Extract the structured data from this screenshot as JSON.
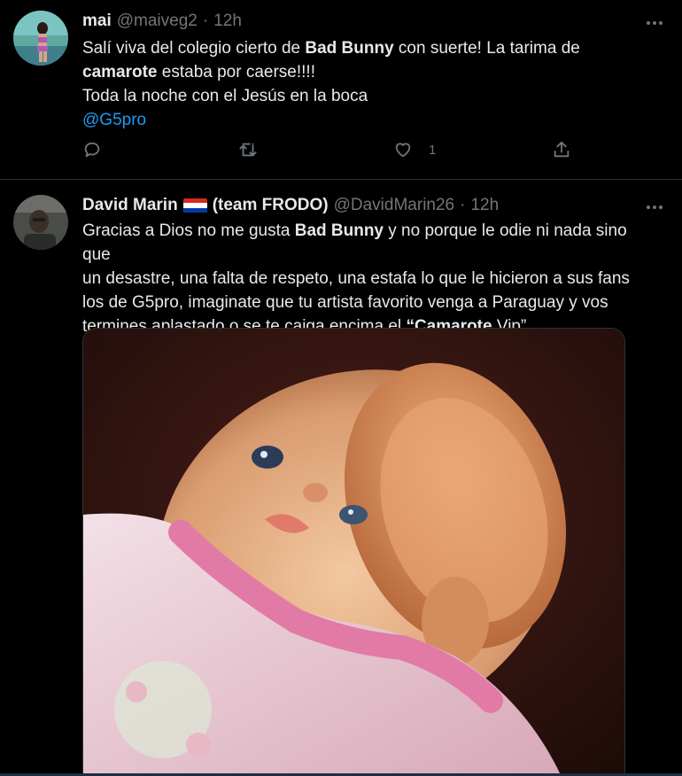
{
  "tweet1": {
    "display_name": "mai",
    "handle": "@maiveg2",
    "separator": "·",
    "time": "12h",
    "text": {
      "l1_a": "Salí viva del colegio cierto de ",
      "l1_b": "Bad Bunny",
      "l1_c": " con suerte! La tarima de",
      "l2_a": "camarote",
      "l2_b": " estaba por caerse!!!!",
      "l3": "Toda la noche con el Jesús en la boca",
      "mention": "@G5pro"
    },
    "actions": {
      "reply_icon": "reply-icon",
      "retweet_icon": "retweet-icon",
      "like_icon": "heart-icon",
      "like_count": "1",
      "share_icon": "share-icon"
    }
  },
  "tweet2": {
    "display_name": "David Marin",
    "flag_icon": "paraguay-flag-icon",
    "team": "(team FRODO)",
    "handle": "@DavidMarin26",
    "separator": "·",
    "time": "12h",
    "text": {
      "l1_a": "Gracias a Dios no me gusta ",
      "l1_b": "Bad Bunny",
      "l1_c": " y no porque le odie ni nada sino que",
      "l2": "un desastre, una falta de respeto, una estafa lo que le hicieron a sus fans",
      "l3": "los de G5pro, imaginate que tu artista favorito venga a Paraguay y vos",
      "l4_a": "termines aplastado o se te caiga encima el ",
      "l4_b": "“Camarote",
      "l4_c": " Vip”"
    },
    "media_icon": "doll-photo"
  },
  "colors": {
    "background": "#000000",
    "text": "#e7e9ea",
    "muted": "#71767b",
    "link": "#1d9bf0",
    "divider": "#2f3336"
  }
}
